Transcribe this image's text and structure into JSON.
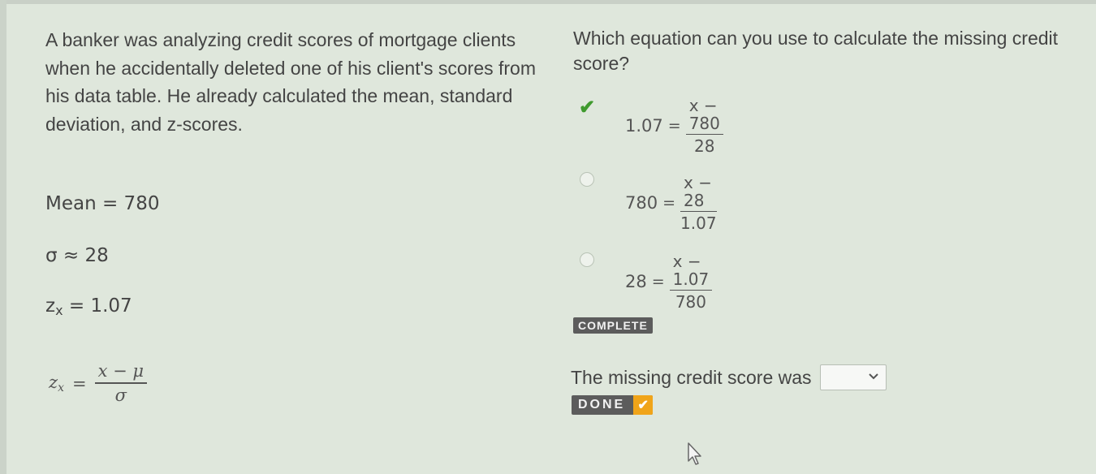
{
  "problem_text": "A banker was analyzing credit scores of mortgage clients when he accidentally deleted one of his client's scores from his data table. He already calculated the mean, standard deviation, and z-scores.",
  "stats": {
    "mean": "Mean = 780",
    "sigma": "σ ≈ 28",
    "z_label": "z",
    "z_sub": "x",
    "z_value": "= 1.07"
  },
  "formula": {
    "lhs": "z",
    "lhs_sub": "x",
    "equals": "=",
    "numerator": "x − μ",
    "denominator": "σ"
  },
  "question": "Which equation can you use to calculate the missing credit score?",
  "options": [
    {
      "lhs": "1.07",
      "equals": "=",
      "numerator": "x − 780",
      "denominator": "28",
      "state": "checked"
    },
    {
      "lhs": "780",
      "equals": "=",
      "numerator": "x − 28",
      "denominator": "1.07",
      "state": "unselected"
    },
    {
      "lhs": "28",
      "equals": "=",
      "numerator": "x − 1.07",
      "denominator": "780",
      "state": "unselected"
    }
  ],
  "complete_badge": "COMPLETE",
  "answer_prompt": "The missing credit score was",
  "answer_dropdown": {
    "selected": ""
  },
  "done_button": "DONE",
  "icons": {
    "check": "check-icon",
    "dropdown": "chevron-down-icon",
    "cursor": "mouse-pointer-icon"
  },
  "colors": {
    "check_green": "#3f9a2e",
    "done_accent": "#f0a419",
    "badge_bg": "#5c5c5c"
  }
}
